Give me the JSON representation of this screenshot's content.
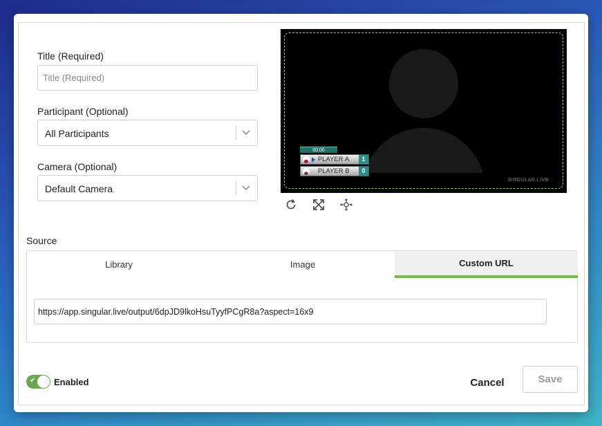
{
  "form": {
    "title_label": "Title (Required)",
    "title_placeholder": "Title (Required)",
    "title_value": "",
    "participant_label": "Participant (Optional)",
    "participant_value": "All Participants",
    "camera_label": "Camera (Optional)",
    "camera_value": "Default Camera"
  },
  "preview": {
    "scoreboard": {
      "time": "00:00",
      "players": [
        {
          "name": "PLAYER A",
          "score": "1",
          "flag": "japan"
        },
        {
          "name": "PLAYER B",
          "score": "0",
          "flag": "south-korea"
        }
      ]
    },
    "watermark": "SINGULAR.LIVE"
  },
  "source": {
    "label": "Source",
    "tabs": [
      {
        "label": "Library",
        "active": false
      },
      {
        "label": "Image",
        "active": false
      },
      {
        "label": "Custom URL",
        "active": true
      }
    ],
    "url_value": "https://app.singular.live/output/6dpJD9lkoHsuTyyfPCgR8a?aspect=16x9"
  },
  "footer": {
    "toggle_label": "Enabled",
    "toggle_on": true,
    "cancel_label": "Cancel",
    "save_label": "Save"
  },
  "colors": {
    "accent_green": "#6cc04a",
    "toggle_green": "#6aa84f"
  },
  "icons": [
    "refresh-icon",
    "fullscreen-icon",
    "move-icon",
    "chevron-down-icon"
  ]
}
